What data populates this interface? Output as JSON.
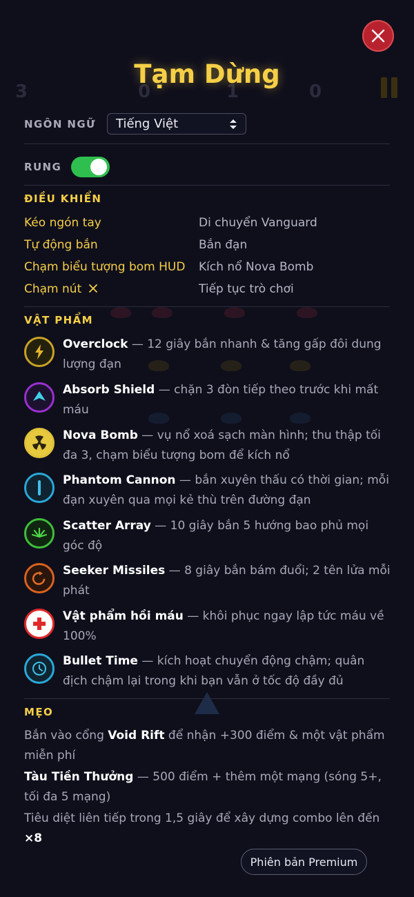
{
  "title": "Tạm Dừng",
  "language": {
    "label": "NGÔN NGỮ",
    "selected": "Tiếng Việt"
  },
  "vibration": {
    "label": "RUNG",
    "enabled": true
  },
  "controls": {
    "heading": "ĐIỀU KHIỂN",
    "rows": [
      {
        "key": "Kéo ngón tay",
        "value": "Di chuyển Vanguard"
      },
      {
        "key": "Tự động bắn",
        "value": "Bắn đạn"
      },
      {
        "key": "Chạm biểu tượng bom HUD",
        "value": "Kích nổ Nova Bomb"
      },
      {
        "key": "Chạm nút",
        "value": "Tiếp tục trò chơi"
      }
    ]
  },
  "items": {
    "heading": "VẬT PHẨM",
    "list": [
      {
        "name": "Overclock",
        "desc": " — 12 giây bắn nhanh & tăng gấp đôi dung lượng đạn",
        "icon": "lightning-icon",
        "color": "#c9a227"
      },
      {
        "name": "Absorb Shield",
        "desc": " — chặn 3 đòn tiếp theo trước khi mất máu",
        "icon": "shield-arrow-icon",
        "color": "#9a2fd0"
      },
      {
        "name": "Nova Bomb",
        "desc": " — vụ nổ xoá sạch màn hình; thu thập tối đa 3, chạm biểu tượng bom để kích nổ",
        "icon": "radiation-icon",
        "color": "#e0c23a"
      },
      {
        "name": "Phantom Cannon",
        "desc": " — bắn xuyên thấu có thời gian; mỗi đạn xuyên qua mọi kẻ thù trên đường đạn",
        "icon": "beam-icon",
        "color": "#2aa8d8"
      },
      {
        "name": "Scatter Array",
        "desc": " — 10 giây bắn 5 hướng bao phủ mọi góc độ",
        "icon": "scatter-icon",
        "color": "#3fbf3a"
      },
      {
        "name": "Seeker Missiles",
        "desc": " — 8 giây bắn bám đuổi; 2 tên lửa mỗi phát",
        "icon": "homing-icon",
        "color": "#d9621f"
      },
      {
        "name": "Vật phẩm hồi máu",
        "desc": " — khôi phục ngay lập tức máu về 100%",
        "icon": "health-cross-icon",
        "color": "#e02a2a"
      },
      {
        "name": "Bullet Time",
        "desc": " — kích hoạt chuyển động chậm; quân địch chậm lại trong khi bạn vẫn ở tốc độ đầy đủ",
        "icon": "clock-icon",
        "color": "#2aa8d8"
      }
    ]
  },
  "tips": {
    "heading": "MẸO",
    "tip1_pre": "Bắn vào cổng ",
    "tip1_bold": "Void Rift",
    "tip1_post": " để nhận +300 điểm & một vật phẩm miễn phí",
    "tip2_bold": "Tàu Tiền Thưởng",
    "tip2_post": " — 500 điểm + thêm một mạng (sóng 5+, tối đa 5 mạng)",
    "tip3_pre": "Tiêu diệt liên tiếp trong 1,5 giây để xây dựng combo lên đến ",
    "tip3_bold": "×8"
  },
  "premium_label": "Phiên bản Premium",
  "background_hud": [
    "3",
    "0",
    "1",
    "0"
  ],
  "colors": {
    "accent": "#f6cf47",
    "toggle_on": "#2fbf4e",
    "close": "#b8222e"
  }
}
